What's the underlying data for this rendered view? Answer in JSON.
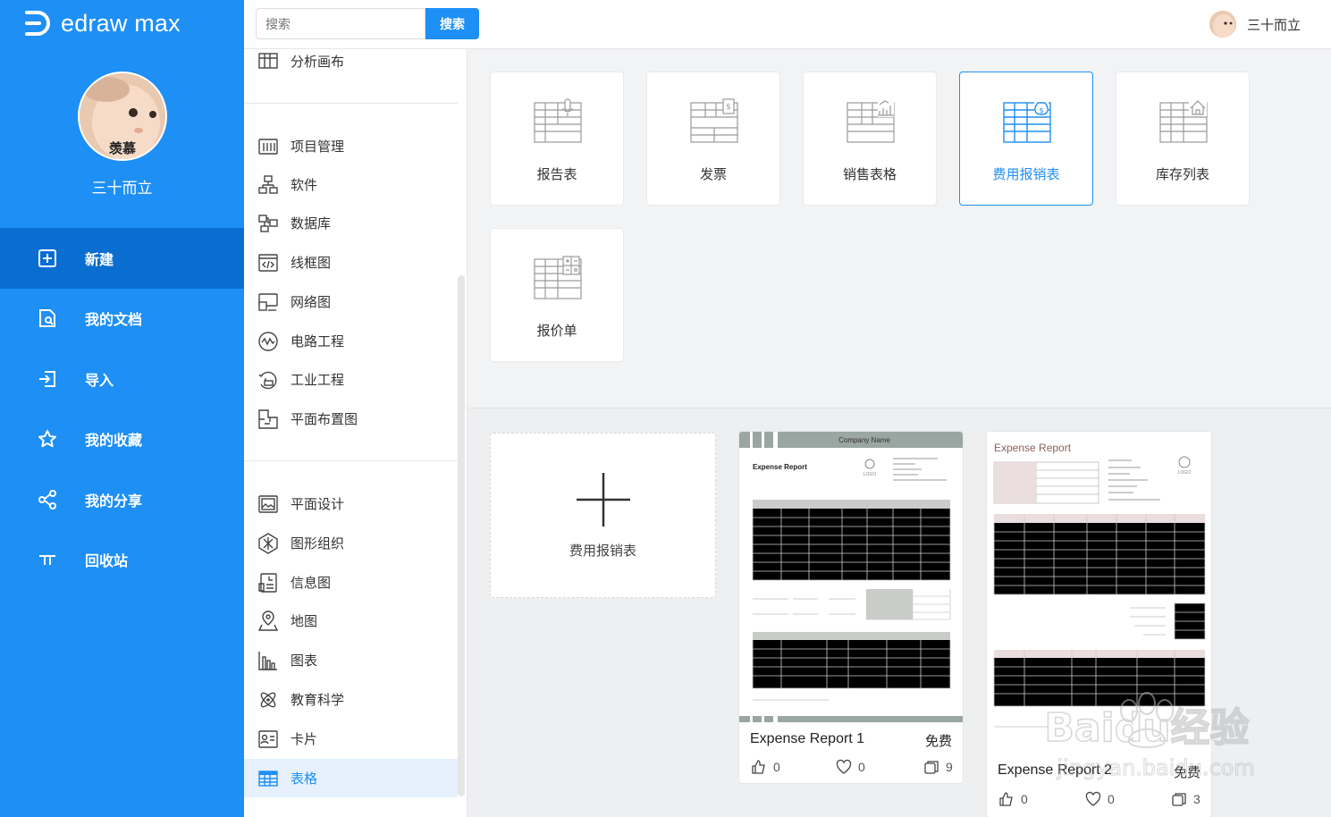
{
  "app": {
    "logo_text": "edraw max"
  },
  "user": {
    "name": "三十而立",
    "avatar_caption": "羡慕"
  },
  "search": {
    "placeholder": "搜索",
    "button": "搜索"
  },
  "nav": [
    {
      "label": "新建",
      "icon": "new-file-icon",
      "active": true
    },
    {
      "label": "我的文档",
      "icon": "documents-icon"
    },
    {
      "label": "导入",
      "icon": "import-icon"
    },
    {
      "label": "我的收藏",
      "icon": "star-icon"
    },
    {
      "label": "我的分享",
      "icon": "share-icon"
    },
    {
      "label": "回收站",
      "icon": "trash-icon"
    }
  ],
  "categories": [
    {
      "label": "分析画布",
      "icon": "canvas-icon"
    },
    {
      "label": "项目管理",
      "icon": "project-icon"
    },
    {
      "label": "软件",
      "icon": "software-icon"
    },
    {
      "label": "数据库",
      "icon": "database-icon"
    },
    {
      "label": "线框图",
      "icon": "wireframe-icon"
    },
    {
      "label": "网络图",
      "icon": "network-icon"
    },
    {
      "label": "电路工程",
      "icon": "circuit-icon"
    },
    {
      "label": "工业工程",
      "icon": "industrial-icon"
    },
    {
      "label": "平面布置图",
      "icon": "floorplan-icon"
    },
    {
      "label": "平面设计",
      "icon": "graphic-design-icon"
    },
    {
      "label": "图形组织",
      "icon": "graphic-organizer-icon"
    },
    {
      "label": "信息图",
      "icon": "infographic-icon"
    },
    {
      "label": "地图",
      "icon": "map-icon"
    },
    {
      "label": "图表",
      "icon": "chart-icon"
    },
    {
      "label": "教育科学",
      "icon": "science-icon"
    },
    {
      "label": "卡片",
      "icon": "card-icon"
    },
    {
      "label": "表格",
      "icon": "table-icon",
      "active": true
    }
  ],
  "templates": [
    {
      "label": "报告表",
      "icon": "report-table-icon"
    },
    {
      "label": "发票",
      "icon": "invoice-icon"
    },
    {
      "label": "销售表格",
      "icon": "sales-table-icon"
    },
    {
      "label": "费用报销表",
      "icon": "expense-table-icon",
      "active": true
    },
    {
      "label": "库存列表",
      "icon": "inventory-icon"
    },
    {
      "label": "报价单",
      "icon": "quotation-icon"
    }
  ],
  "new_card": {
    "label": "费用报销表"
  },
  "docs": [
    {
      "title": "Expense Report 1",
      "price": "免费",
      "likes": "0",
      "favorites": "0",
      "copies": "9",
      "thumb": {
        "company": "Company Name",
        "heading": "Expense Report",
        "logo": "LOGO"
      }
    },
    {
      "title": "Expense Report 2",
      "price": "免费",
      "likes": "0",
      "favorites": "0",
      "copies": "3",
      "thumb": {
        "heading": "Expense Report",
        "logo": "LOGO"
      }
    }
  ],
  "watermark": {
    "line1": "Baidu经验",
    "line2": "jingyan.baidu.com"
  },
  "colors": {
    "primary": "#1e8ff5",
    "nav_active": "#0a6ed1",
    "thumb_header": "#9aa6a2",
    "thumb_accent": "#8b5e5e"
  }
}
